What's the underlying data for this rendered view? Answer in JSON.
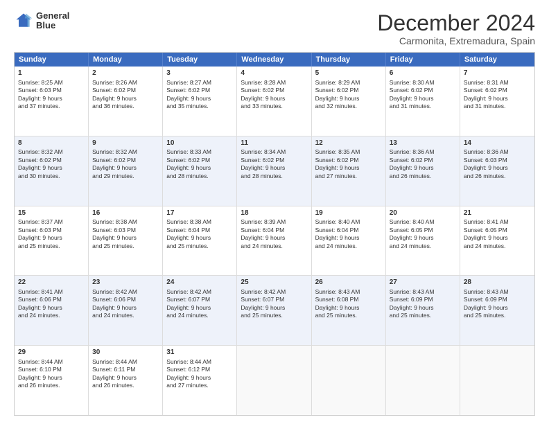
{
  "logo": {
    "line1": "General",
    "line2": "Blue"
  },
  "title": "December 2024",
  "subtitle": "Carmonita, Extremadura, Spain",
  "days": [
    "Sunday",
    "Monday",
    "Tuesday",
    "Wednesday",
    "Thursday",
    "Friday",
    "Saturday"
  ],
  "weeks": [
    [
      {
        "num": "1",
        "lines": [
          "Sunrise: 8:25 AM",
          "Sunset: 6:03 PM",
          "Daylight: 9 hours",
          "and 37 minutes."
        ]
      },
      {
        "num": "2",
        "lines": [
          "Sunrise: 8:26 AM",
          "Sunset: 6:02 PM",
          "Daylight: 9 hours",
          "and 36 minutes."
        ]
      },
      {
        "num": "3",
        "lines": [
          "Sunrise: 8:27 AM",
          "Sunset: 6:02 PM",
          "Daylight: 9 hours",
          "and 35 minutes."
        ]
      },
      {
        "num": "4",
        "lines": [
          "Sunrise: 8:28 AM",
          "Sunset: 6:02 PM",
          "Daylight: 9 hours",
          "and 33 minutes."
        ]
      },
      {
        "num": "5",
        "lines": [
          "Sunrise: 8:29 AM",
          "Sunset: 6:02 PM",
          "Daylight: 9 hours",
          "and 32 minutes."
        ]
      },
      {
        "num": "6",
        "lines": [
          "Sunrise: 8:30 AM",
          "Sunset: 6:02 PM",
          "Daylight: 9 hours",
          "and 31 minutes."
        ]
      },
      {
        "num": "7",
        "lines": [
          "Sunrise: 8:31 AM",
          "Sunset: 6:02 PM",
          "Daylight: 9 hours",
          "and 31 minutes."
        ]
      }
    ],
    [
      {
        "num": "8",
        "lines": [
          "Sunrise: 8:32 AM",
          "Sunset: 6:02 PM",
          "Daylight: 9 hours",
          "and 30 minutes."
        ]
      },
      {
        "num": "9",
        "lines": [
          "Sunrise: 8:32 AM",
          "Sunset: 6:02 PM",
          "Daylight: 9 hours",
          "and 29 minutes."
        ]
      },
      {
        "num": "10",
        "lines": [
          "Sunrise: 8:33 AM",
          "Sunset: 6:02 PM",
          "Daylight: 9 hours",
          "and 28 minutes."
        ]
      },
      {
        "num": "11",
        "lines": [
          "Sunrise: 8:34 AM",
          "Sunset: 6:02 PM",
          "Daylight: 9 hours",
          "and 28 minutes."
        ]
      },
      {
        "num": "12",
        "lines": [
          "Sunrise: 8:35 AM",
          "Sunset: 6:02 PM",
          "Daylight: 9 hours",
          "and 27 minutes."
        ]
      },
      {
        "num": "13",
        "lines": [
          "Sunrise: 8:36 AM",
          "Sunset: 6:02 PM",
          "Daylight: 9 hours",
          "and 26 minutes."
        ]
      },
      {
        "num": "14",
        "lines": [
          "Sunrise: 8:36 AM",
          "Sunset: 6:03 PM",
          "Daylight: 9 hours",
          "and 26 minutes."
        ]
      }
    ],
    [
      {
        "num": "15",
        "lines": [
          "Sunrise: 8:37 AM",
          "Sunset: 6:03 PM",
          "Daylight: 9 hours",
          "and 25 minutes."
        ]
      },
      {
        "num": "16",
        "lines": [
          "Sunrise: 8:38 AM",
          "Sunset: 6:03 PM",
          "Daylight: 9 hours",
          "and 25 minutes."
        ]
      },
      {
        "num": "17",
        "lines": [
          "Sunrise: 8:38 AM",
          "Sunset: 6:04 PM",
          "Daylight: 9 hours",
          "and 25 minutes."
        ]
      },
      {
        "num": "18",
        "lines": [
          "Sunrise: 8:39 AM",
          "Sunset: 6:04 PM",
          "Daylight: 9 hours",
          "and 24 minutes."
        ]
      },
      {
        "num": "19",
        "lines": [
          "Sunrise: 8:40 AM",
          "Sunset: 6:04 PM",
          "Daylight: 9 hours",
          "and 24 minutes."
        ]
      },
      {
        "num": "20",
        "lines": [
          "Sunrise: 8:40 AM",
          "Sunset: 6:05 PM",
          "Daylight: 9 hours",
          "and 24 minutes."
        ]
      },
      {
        "num": "21",
        "lines": [
          "Sunrise: 8:41 AM",
          "Sunset: 6:05 PM",
          "Daylight: 9 hours",
          "and 24 minutes."
        ]
      }
    ],
    [
      {
        "num": "22",
        "lines": [
          "Sunrise: 8:41 AM",
          "Sunset: 6:06 PM",
          "Daylight: 9 hours",
          "and 24 minutes."
        ]
      },
      {
        "num": "23",
        "lines": [
          "Sunrise: 8:42 AM",
          "Sunset: 6:06 PM",
          "Daylight: 9 hours",
          "and 24 minutes."
        ]
      },
      {
        "num": "24",
        "lines": [
          "Sunrise: 8:42 AM",
          "Sunset: 6:07 PM",
          "Daylight: 9 hours",
          "and 24 minutes."
        ]
      },
      {
        "num": "25",
        "lines": [
          "Sunrise: 8:42 AM",
          "Sunset: 6:07 PM",
          "Daylight: 9 hours",
          "and 25 minutes."
        ]
      },
      {
        "num": "26",
        "lines": [
          "Sunrise: 8:43 AM",
          "Sunset: 6:08 PM",
          "Daylight: 9 hours",
          "and 25 minutes."
        ]
      },
      {
        "num": "27",
        "lines": [
          "Sunrise: 8:43 AM",
          "Sunset: 6:09 PM",
          "Daylight: 9 hours",
          "and 25 minutes."
        ]
      },
      {
        "num": "28",
        "lines": [
          "Sunrise: 8:43 AM",
          "Sunset: 6:09 PM",
          "Daylight: 9 hours",
          "and 25 minutes."
        ]
      }
    ],
    [
      {
        "num": "29",
        "lines": [
          "Sunrise: 8:44 AM",
          "Sunset: 6:10 PM",
          "Daylight: 9 hours",
          "and 26 minutes."
        ]
      },
      {
        "num": "30",
        "lines": [
          "Sunrise: 8:44 AM",
          "Sunset: 6:11 PM",
          "Daylight: 9 hours",
          "and 26 minutes."
        ]
      },
      {
        "num": "31",
        "lines": [
          "Sunrise: 8:44 AM",
          "Sunset: 6:12 PM",
          "Daylight: 9 hours",
          "and 27 minutes."
        ]
      },
      null,
      null,
      null,
      null
    ]
  ]
}
